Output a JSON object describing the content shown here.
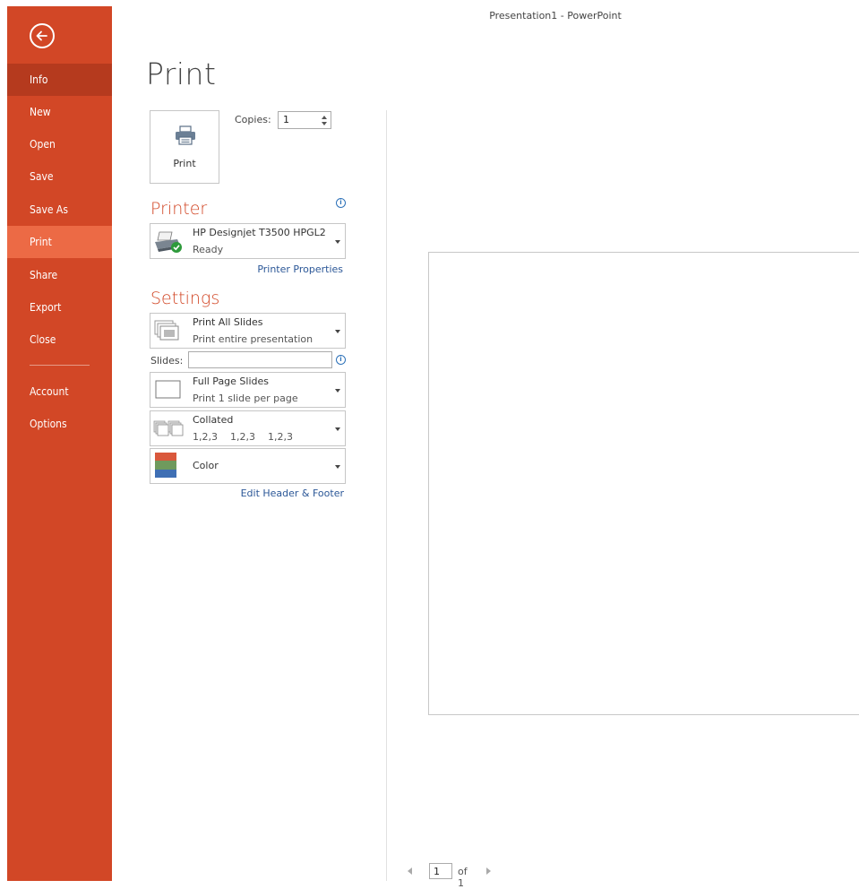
{
  "window": {
    "title": "Presentation1 - PowerPoint"
  },
  "sidebar": {
    "items": [
      {
        "label": "Info"
      },
      {
        "label": "New"
      },
      {
        "label": "Open"
      },
      {
        "label": "Save"
      },
      {
        "label": "Save As"
      },
      {
        "label": "Print"
      },
      {
        "label": "Share"
      },
      {
        "label": "Export"
      },
      {
        "label": "Close"
      },
      {
        "label": "Account"
      },
      {
        "label": "Options"
      }
    ],
    "active": "Print"
  },
  "print": {
    "title": "Print",
    "button_label": "Print",
    "copies_label": "Copies:",
    "copies_value": "1"
  },
  "printer": {
    "heading": "Printer",
    "name": "HP Designjet T3500 HPGL2",
    "status": "Ready",
    "properties_link": "Printer Properties"
  },
  "settings": {
    "heading": "Settings",
    "range": {
      "main": "Print All Slides",
      "sub": "Print entire presentation"
    },
    "slides_label": "Slides:",
    "slides_value": "",
    "layout": {
      "main": "Full Page Slides",
      "sub": "Print 1 slide per page"
    },
    "collation": {
      "main": "Collated",
      "sub": "1,2,3    1,2,3    1,2,3"
    },
    "color": {
      "main": "Color"
    },
    "header_footer_link": "Edit Header & Footer"
  },
  "pager": {
    "current": "1",
    "total": "of 1"
  },
  "colors": {
    "accent": "#d24726",
    "nav_active": "#ec6a45",
    "nav_selected": "#b53a1e",
    "link": "#2b5797"
  }
}
